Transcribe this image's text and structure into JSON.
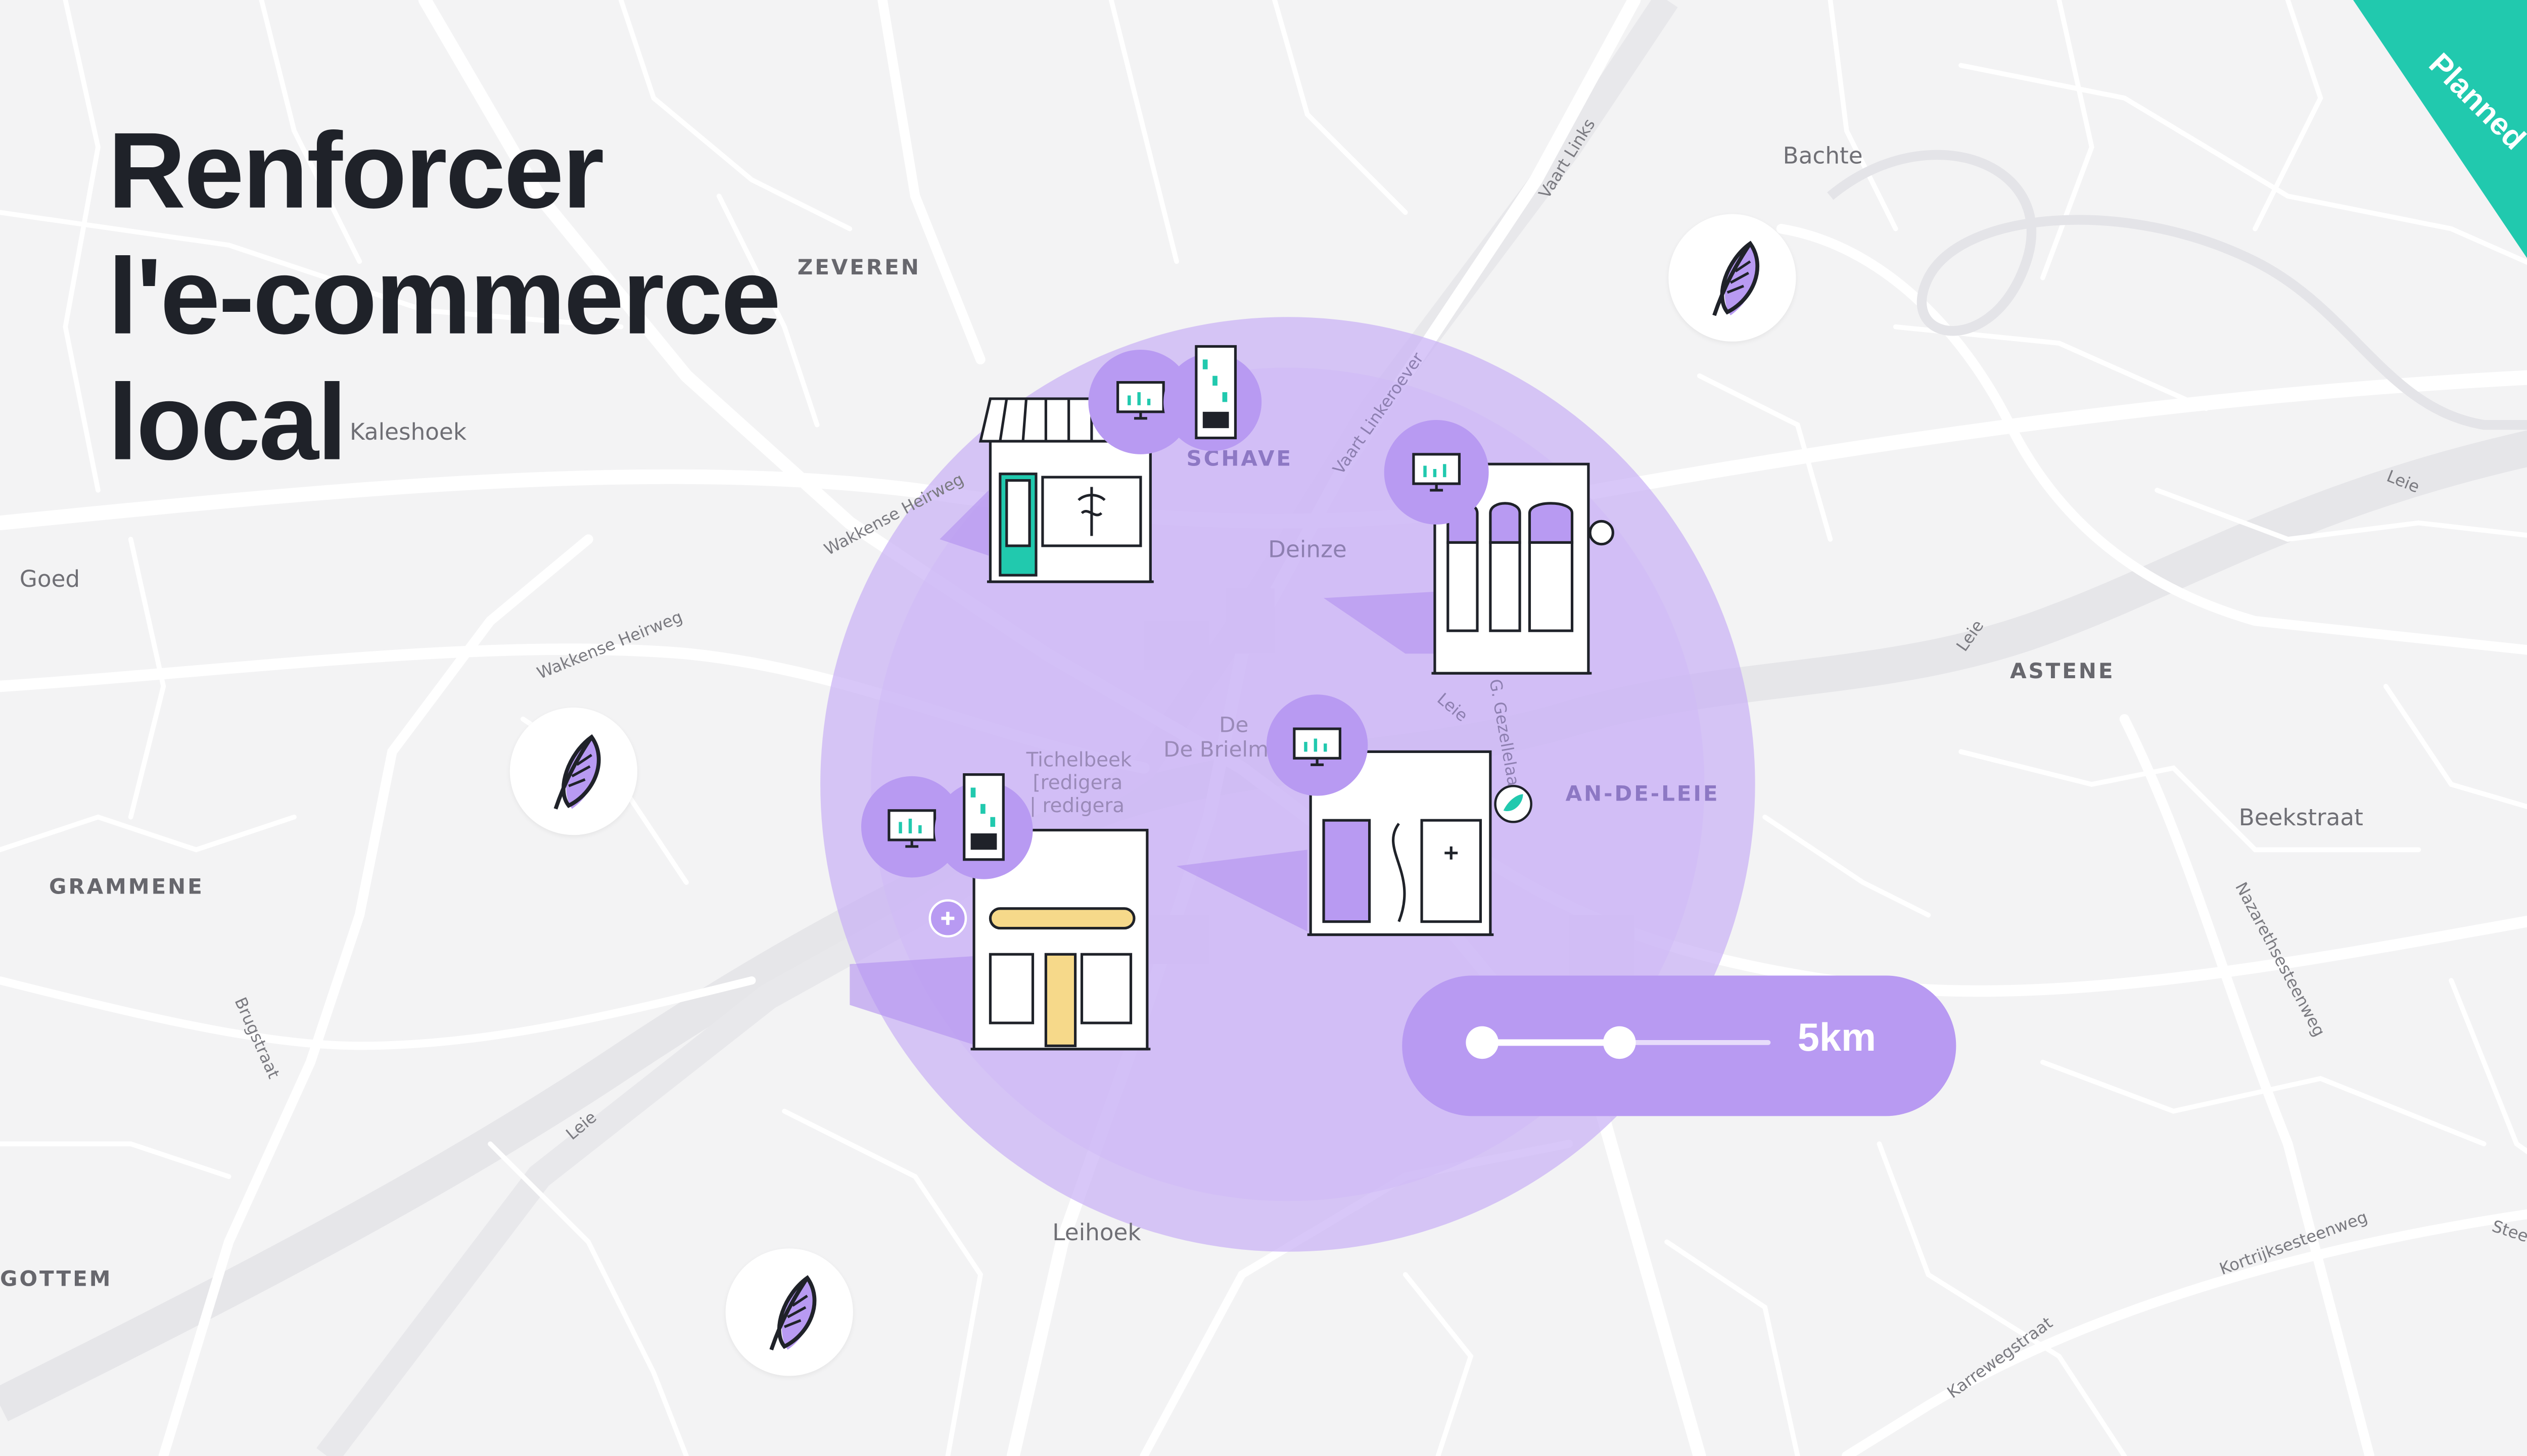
{
  "slide": {
    "title_lines": [
      "Renforcer",
      "l'e-commerce",
      "local"
    ],
    "status_badge": "Planned",
    "colors": {
      "accent_purple": "#b89af2",
      "radius_fill": "#c9b2f5",
      "badge_teal": "#21c9ae",
      "title_text": "#1f2229",
      "map_background": "#f3f3f4"
    }
  },
  "map": {
    "places": {
      "zeveren": "ZEVEREN",
      "kaleshoek": "Kaleshoek",
      "goed": "Goed",
      "grammene": "GRAMMENE",
      "gottem": "GOTTEM",
      "schave": "SCHAVE",
      "deinze": "Deinze",
      "de_brielmeersen": "De Brielmeer",
      "tichelbeek_1": "Tichelbeek",
      "tichelbeek_2": "[redigera",
      "tichelbeek_3": "| redigera",
      "an_de_leie": "AN-DE-LEIE",
      "bachte": "Bachte",
      "astene": "ASTENE",
      "beekstraat": "Beekstraat",
      "leihoek": "Leihoek"
    },
    "roads": {
      "wakkense_heirweg_1": "Wakkense Heirweg",
      "wakkense_heirweg_2": "Wakkense Heirweg",
      "vaart_links": "Vaart Links",
      "vaart_linkeroever": "Vaart Linkeroever",
      "leie_top_right": "Leie",
      "leie_right": "Leie",
      "leie_center": "Leie",
      "leie_bottom_left": "Leie",
      "gezellelaan": "G. Gezellelaan",
      "nazarethsesteenweg": "Nazarethsesteenweg",
      "brugstraat": "Brugstraat",
      "kortrijksesteenweg": "Kortrijksesteenweg",
      "karrewegstraat": "Karrewegstraat",
      "steenweg_edge": "Steenwe"
    },
    "icons": [
      "leaf-icon",
      "storefront-icon",
      "monitor-icon",
      "vending-machine-icon",
      "plus-icon",
      "sign-icon"
    ]
  },
  "radius_control": {
    "value_label": "5km",
    "position_fraction": 0.48
  }
}
